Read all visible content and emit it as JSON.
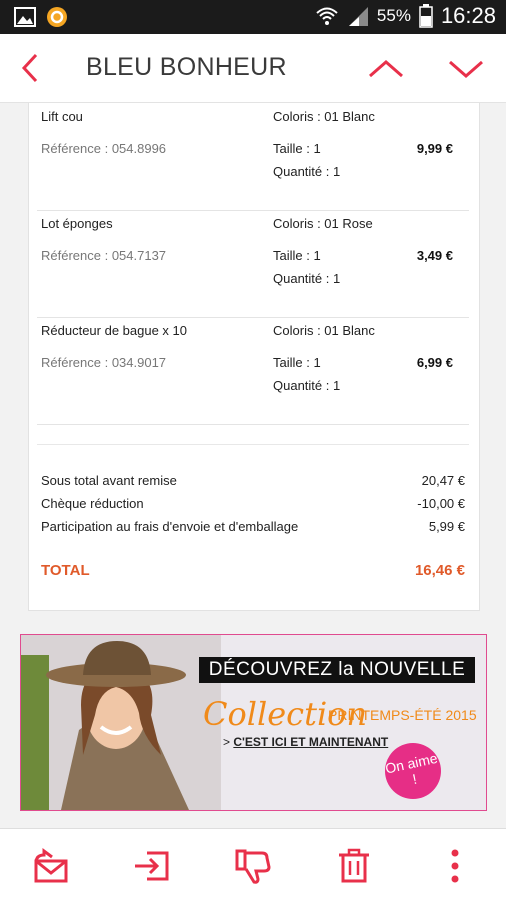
{
  "status_bar": {
    "wifi_icon": "wifi-icon",
    "signal_icon": "signal-icon",
    "battery_percent": "55%",
    "battery_level": 0.55,
    "time": "16:28"
  },
  "app_bar": {
    "title": "BLEU BONHEUR"
  },
  "order_items": [
    {
      "name": "Lift cou",
      "reference": "Référence : 054.8996",
      "color": "Coloris : 01 Blanc",
      "size": "Taille : 1",
      "quantity": "Quantité : 1",
      "price": "9,99 €"
    },
    {
      "name": "Lot éponges",
      "reference": "Référence : 054.7137",
      "color": "Coloris : 01 Rose",
      "size": "Taille : 1",
      "quantity": "Quantité : 1",
      "price": "3,49 €"
    },
    {
      "name": "Réducteur de bague x 10",
      "reference": "Référence : 034.9017",
      "color": "Coloris : 01 Blanc",
      "size": "Taille : 1",
      "quantity": "Quantité : 1",
      "price": "6,99 €"
    }
  ],
  "summary": {
    "subtotal_label": "Sous total avant remise",
    "subtotal_value": "20,47 €",
    "voucher_label": "Chèque réduction",
    "voucher_value": "-10,00 €",
    "shipping_label": "Participation au frais d'envoie et d'emballage",
    "shipping_value": "5,99 €",
    "total_label": "TOTAL",
    "total_value": "16,46 €"
  },
  "banner": {
    "headline": "DÉCOUVREZ la NOUVELLE",
    "collection": "Collection",
    "season": "PRINTEMPS-ÉTÉ 2015",
    "cta_prefix": ">",
    "cta": "C'EST ICI ET MAINTENANT",
    "badge": "On aime !",
    "accent_color": "#e62e86"
  },
  "colors": {
    "accent_red": "#e8304a",
    "total_orange": "#e05a2a"
  },
  "toolbar": {
    "icons": [
      "reply-all-icon",
      "move-to-folder-icon",
      "thumbs-down-icon",
      "trash-icon",
      "more-icon"
    ]
  }
}
